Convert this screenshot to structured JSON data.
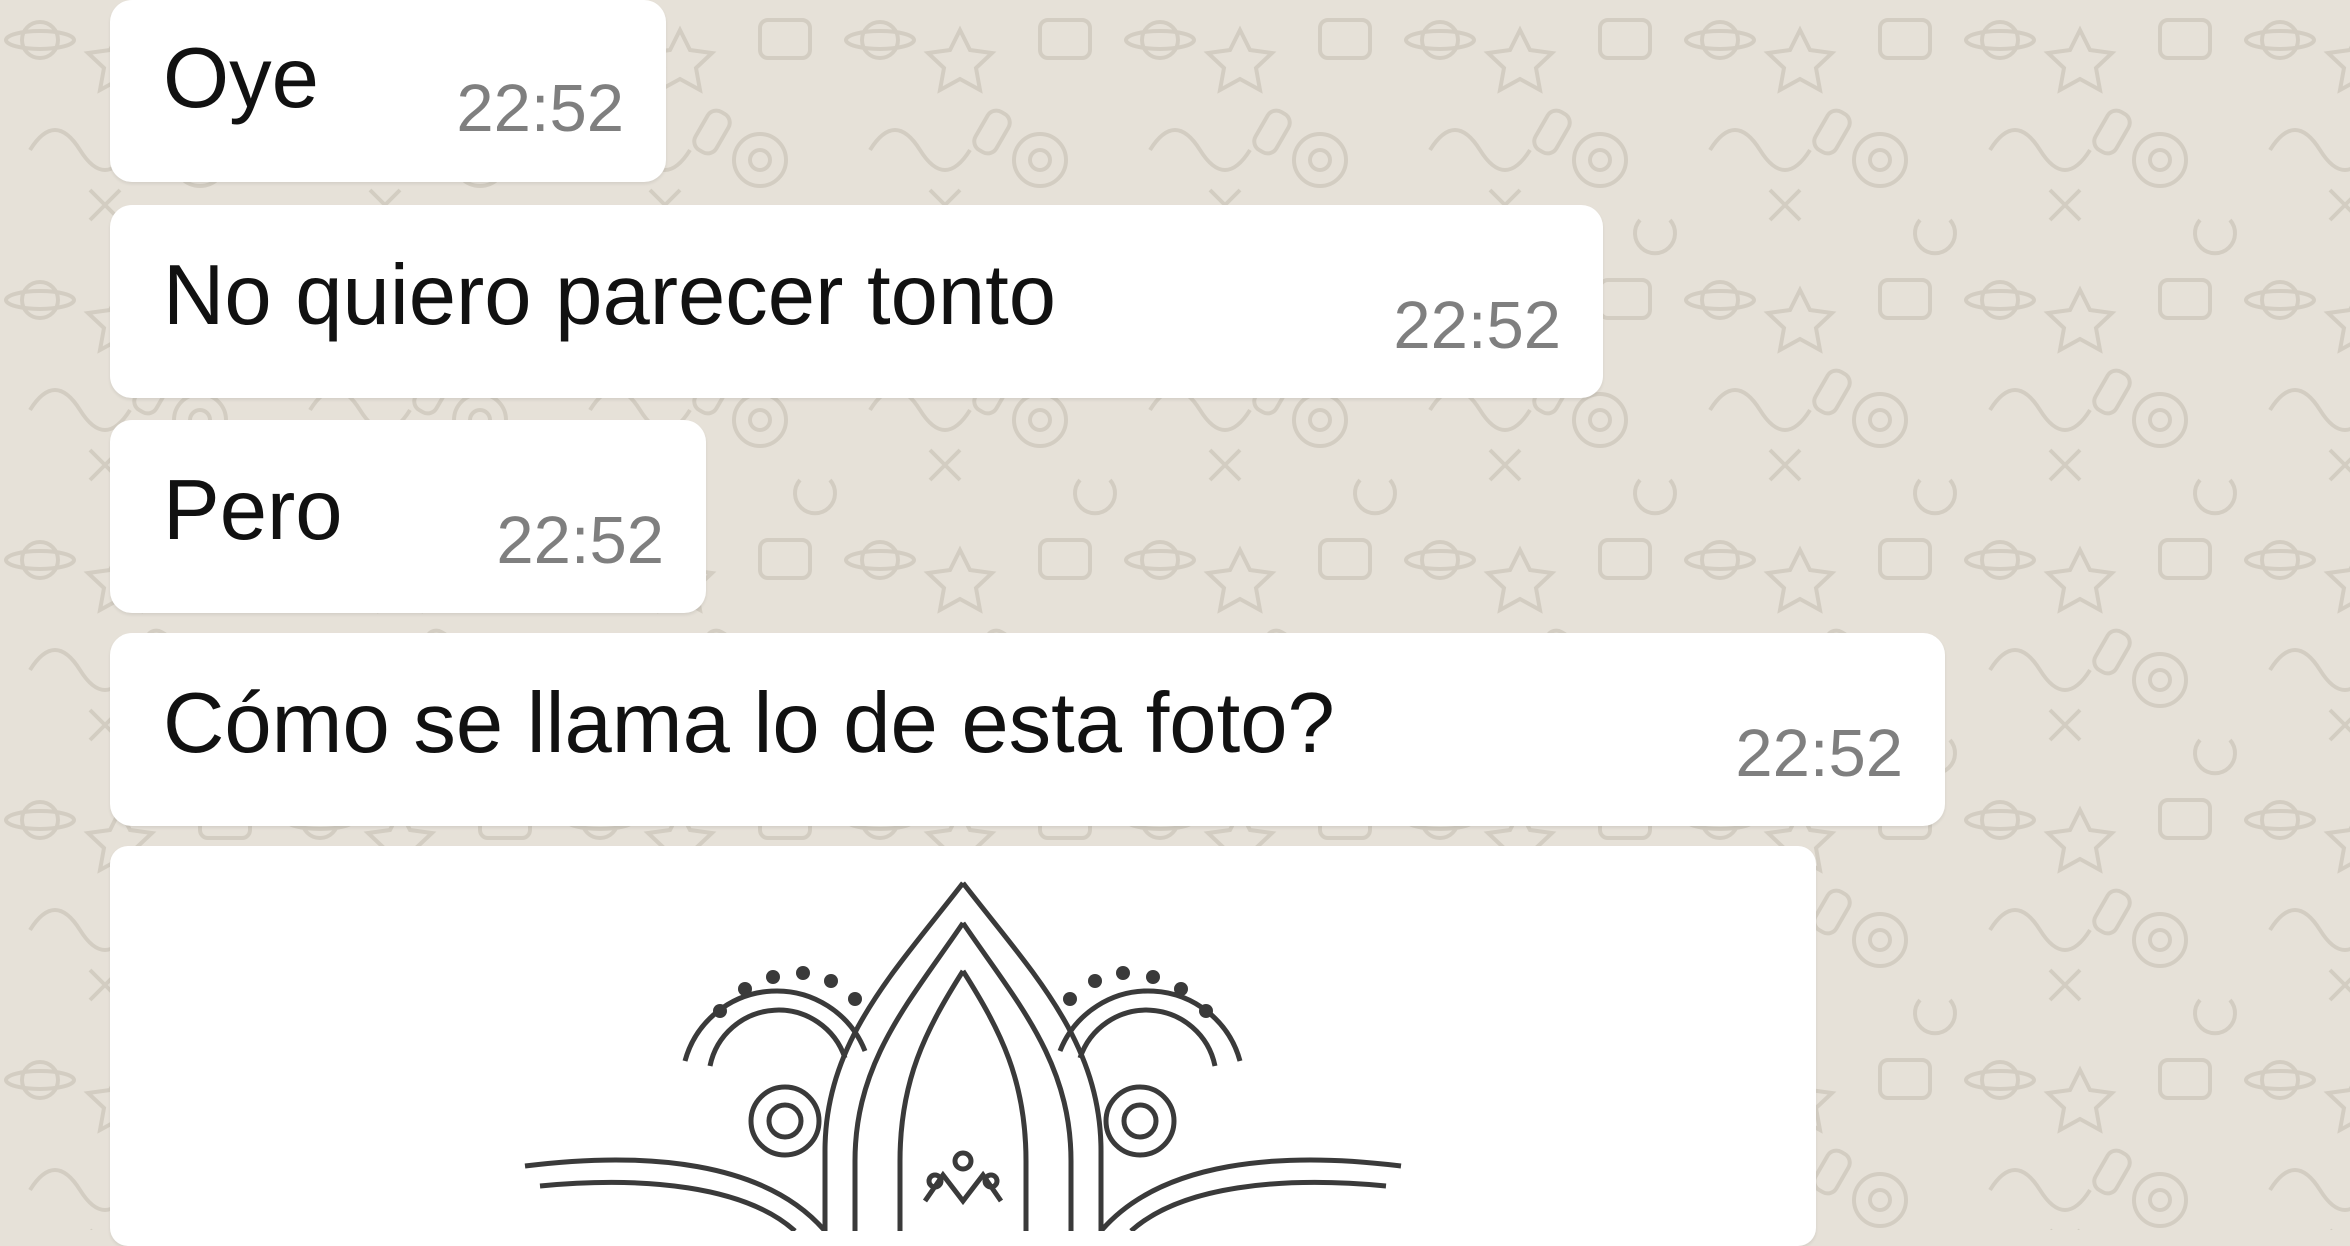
{
  "chat": {
    "wallpaper": "whatsapp-doodle-pattern",
    "background_color": "#e6e1d8",
    "bubble_color": "#ffffff",
    "messages": [
      {
        "text": "Oye",
        "time": "22:52"
      },
      {
        "text": "No quiero parecer tonto",
        "time": "22:52"
      },
      {
        "text": "Pero",
        "time": "22:52"
      },
      {
        "text": "Cómo se llama lo de esta foto?",
        "time": "22:52"
      }
    ],
    "image_message": {
      "content": "mandala-lotus-drawing"
    }
  }
}
